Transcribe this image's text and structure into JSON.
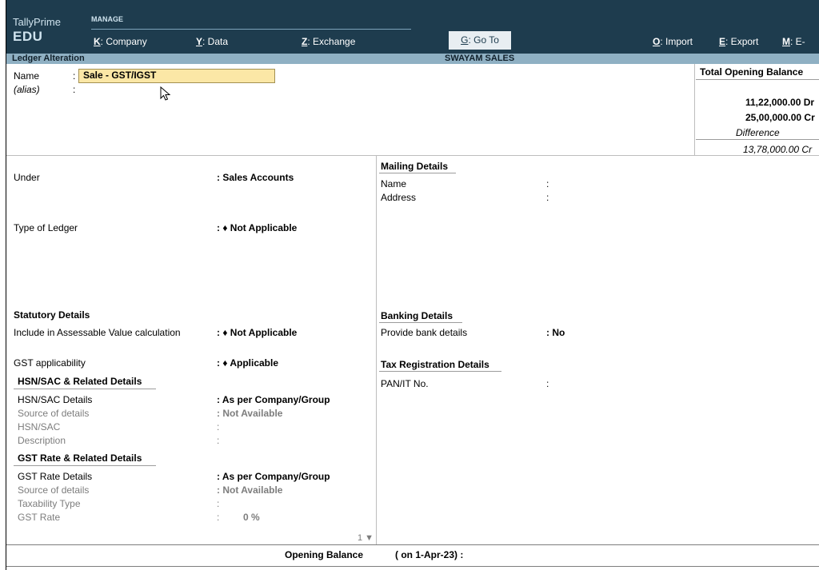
{
  "app": {
    "brand_line1": "TallyPrime",
    "brand_line2": "EDU",
    "section": "MANAGE"
  },
  "menu": {
    "company": {
      "key": "K",
      "label": ": Company"
    },
    "data": {
      "key": "Y",
      "label": ": Data"
    },
    "exchange": {
      "key": "Z",
      "label": ": Exchange"
    },
    "goto": {
      "key": "G",
      "label": ": Go To"
    },
    "import": {
      "key": "O",
      "label": ": Import"
    },
    "export": {
      "key": "E",
      "label": ": Export"
    },
    "email": {
      "key": "M",
      "label": ": E-"
    }
  },
  "header": {
    "title": "Ledger Alteration",
    "company": "SWAYAM SALES"
  },
  "ledger": {
    "name_label": "Name",
    "name_value": "Sale - GST/IGST",
    "alias_label": "(alias)",
    "colon": ":"
  },
  "opening_summary": {
    "title": "Total Opening Balance",
    "dr": "11,22,000.00 Dr",
    "cr": "25,00,000.00 Cr",
    "difference_label": "Difference",
    "difference_value": "13,78,000.00 Cr"
  },
  "left": {
    "under_label": "Under",
    "under_value": ": Sales Accounts",
    "type_label": "Type of Ledger",
    "type_value": ": ♦ Not Applicable",
    "statutory_title": "Statutory Details",
    "assessable_label": "Include in Assessable Value calculation",
    "assessable_value": ": ♦ Not Applicable",
    "gst_app_label": "GST applicability",
    "gst_app_value": ": ♦ Applicable",
    "hsn_title": "HSN/SAC & Related Details",
    "hsn_details_label": "HSN/SAC Details",
    "hsn_details_value": ": As per Company/Group",
    "hsn_source_label": "Source of details",
    "hsn_source_value": ": Not Available",
    "hsn_label": "HSN/SAC",
    "hsn_value": ":",
    "desc_label": "Description",
    "desc_value": ":",
    "gst_rate_title": "GST Rate & Related Details",
    "gst_rate_details_label": "GST Rate Details",
    "gst_rate_details_value": ": As per Company/Group",
    "gst_source_label": "Source of details",
    "gst_source_value": ": Not Available",
    "taxability_label": "Taxability Type",
    "taxability_value": ":",
    "gst_rate_label": "GST Rate",
    "gst_rate_colon": ":",
    "gst_rate_value": "0 %",
    "page_indicator": "1 ▼"
  },
  "right": {
    "mailing_title": "Mailing Details",
    "mail_name_label": "Name",
    "mail_name_value": ":",
    "address_label": "Address",
    "address_value": ":",
    "banking_title": "Banking Details",
    "bank_label": "Provide bank details",
    "bank_value": ": No",
    "tax_title": "Tax Registration Details",
    "pan_label": "PAN/IT No.",
    "pan_value": ":"
  },
  "footer": {
    "label": "Opening Balance",
    "date": "( on 1-Apr-23) :"
  }
}
